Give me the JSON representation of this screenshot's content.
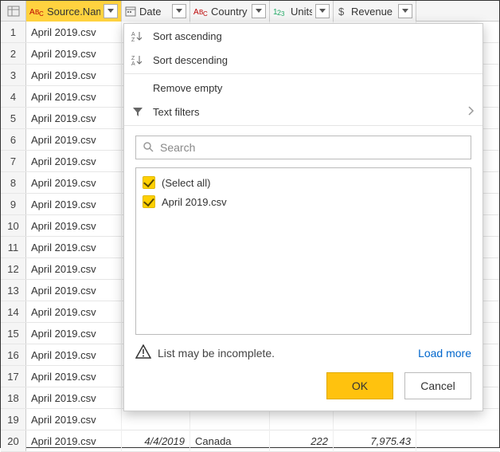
{
  "columns": {
    "source": {
      "label": "Source.Name",
      "type": "text"
    },
    "date": {
      "label": "Date",
      "type": "date"
    },
    "country": {
      "label": "Country",
      "type": "text"
    },
    "units": {
      "label": "Units",
      "type": "number"
    },
    "revenue": {
      "label": "Revenue",
      "type": "currency"
    }
  },
  "rows": [
    {
      "n": 1,
      "source": "April 2019.csv"
    },
    {
      "n": 2,
      "source": "April 2019.csv"
    },
    {
      "n": 3,
      "source": "April 2019.csv"
    },
    {
      "n": 4,
      "source": "April 2019.csv"
    },
    {
      "n": 5,
      "source": "April 2019.csv"
    },
    {
      "n": 6,
      "source": "April 2019.csv"
    },
    {
      "n": 7,
      "source": "April 2019.csv"
    },
    {
      "n": 8,
      "source": "April 2019.csv"
    },
    {
      "n": 9,
      "source": "April 2019.csv"
    },
    {
      "n": 10,
      "source": "April 2019.csv"
    },
    {
      "n": 11,
      "source": "April 2019.csv"
    },
    {
      "n": 12,
      "source": "April 2019.csv"
    },
    {
      "n": 13,
      "source": "April 2019.csv"
    },
    {
      "n": 14,
      "source": "April 2019.csv"
    },
    {
      "n": 15,
      "source": "April 2019.csv"
    },
    {
      "n": 16,
      "source": "April 2019.csv"
    },
    {
      "n": 17,
      "source": "April 2019.csv"
    },
    {
      "n": 18,
      "source": "April 2019.csv"
    },
    {
      "n": 19,
      "source": "April 2019.csv"
    },
    {
      "n": 20,
      "source": "April 2019.csv",
      "date": "4/4/2019",
      "country": "Canada",
      "units": "222",
      "revenue": "7,975.43"
    }
  ],
  "dropdown": {
    "sort_asc": "Sort ascending",
    "sort_desc": "Sort descending",
    "remove_empty": "Remove empty",
    "text_filters": "Text filters",
    "search_placeholder": "Search",
    "select_all": "(Select all)",
    "values": [
      "April 2019.csv"
    ],
    "warn": "List may be incomplete.",
    "load_more": "Load more",
    "ok": "OK",
    "cancel": "Cancel"
  }
}
